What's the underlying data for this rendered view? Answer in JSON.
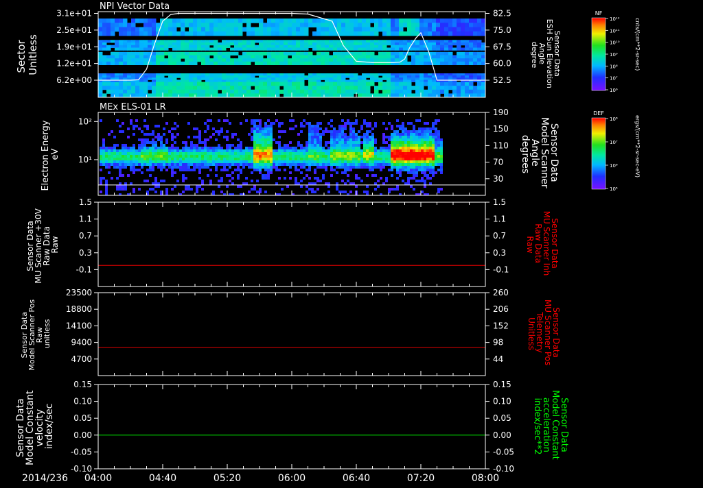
{
  "chart_data": [
    {
      "type": "heatmap",
      "title": "NPI Vector Data",
      "left_axis": {
        "label_lines": [
          "Sector",
          "Unitless"
        ],
        "ticks": [
          "3.1e+01",
          "2.5e+01",
          "1.9e+01",
          "1.2e+01",
          "6.2e+00"
        ]
      },
      "right_axis": {
        "label_lines": [
          "Sensor Data",
          "ESH Sun Elevation",
          "Angle",
          "degree"
        ],
        "ticks": [
          "82.5",
          "75.0",
          "67.5",
          "60.0",
          "52.5"
        ]
      },
      "colorbar": {
        "label": "NF",
        "ticks": [
          "10¹²",
          "10¹¹",
          "10¹⁰",
          "10⁹",
          "10⁸",
          "10⁷",
          "10⁶"
        ],
        "units": "cnts/(cm**2-sr-sec)"
      },
      "overlay_line": {
        "color": "#ffffff",
        "times": [
          "04:00",
          "04:20",
          "04:25",
          "04:30",
          "04:35",
          "04:40",
          "04:45",
          "04:50",
          "05:00",
          "05:40",
          "06:00",
          "06:10",
          "06:25",
          "06:32",
          "06:40",
          "06:50",
          "07:03",
          "07:07",
          "07:10",
          "07:13",
          "07:17",
          "07:20",
          "07:25",
          "07:30",
          "08:00"
        ],
        "values": [
          52.5,
          52.5,
          52.7,
          57.5,
          69,
          79,
          82,
          82.5,
          82.5,
          82.5,
          82.5,
          82.2,
          79,
          68,
          61,
          60.4,
          60.4,
          60.6,
          62,
          67,
          71.5,
          73.8,
          65,
          52.5,
          52.5
        ]
      }
    },
    {
      "type": "heatmap",
      "title": "MEx ELS-01 LR",
      "left_axis": {
        "label_lines": [
          "Electron Energy",
          "eV"
        ],
        "ticks": [
          "10²",
          "10¹"
        ]
      },
      "right_axis": {
        "label_lines": [
          "Sensor Data",
          "Model Scanner",
          "Angle",
          "degrees"
        ],
        "ticks": [
          "190",
          "150",
          "110",
          "70",
          "30"
        ]
      },
      "colorbar": {
        "label": "DEF",
        "ticks": [
          "10⁸",
          "10⁷",
          "10⁶",
          "10⁵"
        ],
        "units": "ergs/(cm**2-sr-sec-eV)"
      },
      "overlay_line": {
        "color": "#ffffff",
        "value": 15
      }
    },
    {
      "type": "line",
      "left_axis": {
        "label_lines": [
          "Sensor Data",
          "MU Scanner +30V",
          "Raw Data",
          "Raw"
        ],
        "color": "#ffffff",
        "ticks": [
          "1.5",
          "1.1",
          "0.7",
          "0.3",
          "-0.1"
        ]
      },
      "right_axis": {
        "label_lines": [
          "Sensor Data",
          "MU Scanner Inh",
          "Raw Data",
          "Raw"
        ],
        "color": "#ff0000",
        "ticks": [
          "1.5",
          "1.1",
          "0.7",
          "0.3",
          "-0.1"
        ]
      },
      "series": [
        {
          "value": 0,
          "color": "#cc0000"
        }
      ]
    },
    {
      "type": "line",
      "left_axis": {
        "label_lines": [
          "Sensor Data",
          "Model Scanner Pos",
          "Raw",
          "unitless"
        ],
        "color": "#ffffff",
        "ticks": [
          "23500",
          "18800",
          "14100",
          "9400",
          "4700"
        ]
      },
      "right_axis": {
        "label_lines": [
          "Sensor Data",
          "MU Scanner Pos",
          "Telemetry",
          "Unitless"
        ],
        "color": "#ff0000",
        "ticks": [
          "260",
          "206",
          "152",
          "98",
          "44"
        ]
      },
      "series": [
        {
          "value": 8000,
          "color": "#cc0000"
        }
      ]
    },
    {
      "type": "line",
      "left_axis": {
        "label_lines": [
          "Sensor Data",
          "Model Constant",
          "velocity",
          "index/sec"
        ],
        "color": "#ffffff",
        "ticks": [
          "0.15",
          "0.10",
          "0.05",
          "0.00",
          "-0.05",
          "-0.10"
        ]
      },
      "right_axis": {
        "label_lines": [
          "Sensor Data",
          "Model Constant",
          "acceleration",
          "index/sec**2"
        ],
        "color": "#00ff00",
        "ticks": [
          "0.15",
          "0.10",
          "0.05",
          "0.00",
          "-0.05",
          "-0.10"
        ]
      },
      "series": [
        {
          "value": 0,
          "color": "#00cc00"
        }
      ]
    }
  ],
  "x_axis": {
    "date_label": "2014/236",
    "ticks": [
      "04:00",
      "04:40",
      "05:20",
      "06:00",
      "06:40",
      "07:20",
      "08:00"
    ]
  }
}
